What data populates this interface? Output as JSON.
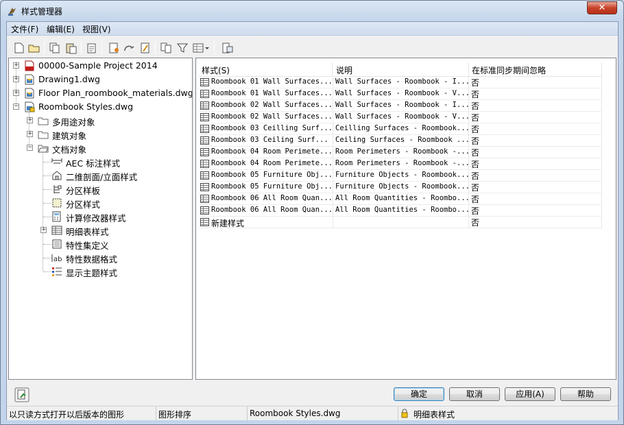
{
  "window": {
    "title": "样式管理器",
    "close_label": "✕"
  },
  "menu": [
    "文件(F)",
    "编辑(E)",
    "视图(V)"
  ],
  "toolbar": {
    "buttons": [
      "new-icon",
      "open-icon",
      "copy-icon",
      "paste-icon",
      "purge-icon",
      "new-style-icon",
      "edit-style-icon",
      "rename-icon",
      "sort-icon",
      "filter-icon",
      "view-mode-icon",
      "toggle-view-icon"
    ]
  },
  "tree": [
    {
      "label": "00000-Sample Project 2014",
      "icon": "project-icon"
    },
    {
      "label": "Drawing1.dwg",
      "icon": "drawing-icon"
    },
    {
      "label": "Floor Plan_roombook_materials.dwg",
      "icon": "drawing-icon"
    },
    {
      "label": "Roombook Styles.dwg",
      "icon": "drawing-locked-icon"
    },
    {
      "label": "多用途对象",
      "icon": "folder-icon"
    },
    {
      "label": "建筑对象",
      "icon": "folder-icon"
    },
    {
      "label": "文档对象",
      "icon": "folder-open-icon"
    },
    {
      "label": "AEC 标注样式",
      "icon": "dimension-style-icon"
    },
    {
      "label": "二维剖面/立面样式",
      "icon": "section-elevation-icon"
    },
    {
      "label": "分区样板",
      "icon": "zone-template-icon"
    },
    {
      "label": "分区样式",
      "icon": "zone-style-icon"
    },
    {
      "label": "计算修改器样式",
      "icon": "calc-modifier-icon"
    },
    {
      "label": "明细表样式",
      "icon": "schedule-table-icon"
    },
    {
      "label": "特性集定义",
      "icon": "property-set-icon"
    },
    {
      "label": "特性数据格式",
      "icon": "property-format-icon"
    },
    {
      "label": "显示主题样式",
      "icon": "display-theme-icon"
    }
  ],
  "list": {
    "columns": [
      "样式(S)",
      "说明",
      "在标准同步期间忽略"
    ],
    "rows": [
      {
        "name": "Roombook 01 Wall Surfaces...",
        "desc": "Wall Surfaces - Roombook - I...",
        "ignore": "否"
      },
      {
        "name": "Roombook 01 Wall Surfaces...",
        "desc": "Wall Surfaces - Roombook - V...",
        "ignore": "否"
      },
      {
        "name": "Roombook 02 Wall Surfaces...",
        "desc": "Wall Surfaces - Roombook - I...",
        "ignore": "否"
      },
      {
        "name": "Roombook 02 Wall Surfaces...",
        "desc": "Wall Surfaces - Roombook - V...",
        "ignore": "否"
      },
      {
        "name": "Roombook 03 Ceilling Surf...",
        "desc": "Ceilling Surfaces - Roombook...",
        "ignore": "否"
      },
      {
        "name": "Roombook 03 Ceiling Surf...",
        "desc": "Ceiling Surfaces - Roombook ...",
        "ignore": "否"
      },
      {
        "name": "Roombook 04 Room Perimete...",
        "desc": "Room Perimeters - Roombook -...",
        "ignore": "否"
      },
      {
        "name": "Roombook 04 Room Perimete...",
        "desc": "Room Perimeters - Roombook -...",
        "ignore": "否"
      },
      {
        "name": "Roombook 05 Furniture Obj...",
        "desc": "Furniture Objects - Roombook...",
        "ignore": "否"
      },
      {
        "name": "Roombook 05 Furniture Obj...",
        "desc": "Furniture Objects - Roombook...",
        "ignore": "否"
      },
      {
        "name": "Roombook 06 All Room Quan...",
        "desc": "All Room Quantities - Roombo...",
        "ignore": "否"
      },
      {
        "name": "Roombook 06 All Room Quan...",
        "desc": "All Room Quantities - Roombo...",
        "ignore": "否"
      },
      {
        "name": "新建样式",
        "desc": "",
        "ignore": "否"
      }
    ]
  },
  "buttons": {
    "ok": "确定",
    "cancel": "取消",
    "apply": "应用(A)",
    "help": "帮助"
  },
  "status": {
    "seg1": "以只读方式打开以后版本的图形",
    "seg2": "图形排序",
    "seg3": "Roombook Styles.dwg",
    "seg4": "明细表样式"
  }
}
